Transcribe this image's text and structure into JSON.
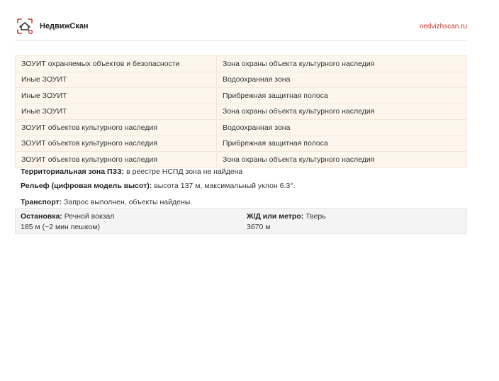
{
  "header": {
    "brand": "НедвижСкан",
    "site_url": "nedvizhscan.ru",
    "logo_icon": "house-scan-logo-icon",
    "accent_color": "#c0392b"
  },
  "zouit_table": {
    "rows": [
      [
        "ЗОУИТ охраняемых объектов и безопасности",
        "Зона охраны объекта культурного наследия"
      ],
      [
        "Иные ЗОУИТ",
        "Водоохранная зона"
      ],
      [
        "Иные ЗОУИТ",
        "Прибрежная защитная полоса"
      ],
      [
        "Иные ЗОУИТ",
        "Зона охраны объекта культурного наследия"
      ],
      [
        "ЗОУИТ объектов культурного наследия",
        "Водоохранная зона"
      ],
      [
        "ЗОУИТ объектов культурного наследия",
        "Прибрежная защитная полоса"
      ],
      [
        "ЗОУИТ объектов культурного наследия",
        "Зона охраны объекта культурного наследия"
      ]
    ]
  },
  "territorial_zone": {
    "label": "Территориальная зона ПЗЗ:",
    "value": "в реестре НСПД зона не найдена"
  },
  "relief": {
    "label": "Рельеф (цифровая модель высот):",
    "value": "высота 137 м, максимальный уклон 6.3°."
  },
  "transport": {
    "label": "Транспорт:",
    "value": "Запрос выполнен, объекты найдены.",
    "stop": {
      "label": "Остановка:",
      "name": "Речной вокзал",
      "distance": "185 м (~2 мин пешком)"
    },
    "rail": {
      "label": "Ж/Д или метро:",
      "name": "Тверь",
      "distance": "3670 м"
    }
  }
}
